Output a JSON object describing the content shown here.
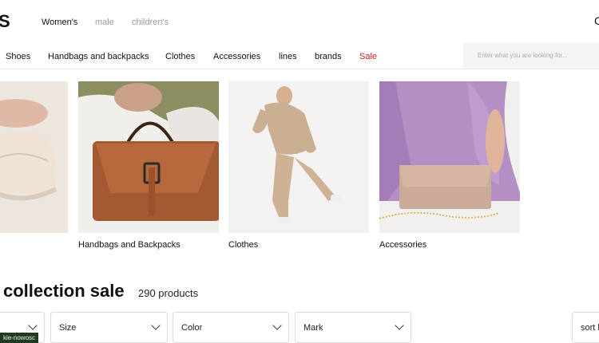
{
  "header": {
    "logo_fragment": "S",
    "genders": [
      "Women's",
      "male",
      "children's"
    ],
    "right_fragment": "C"
  },
  "nav": {
    "items": [
      "Shoes",
      "Handbags and backpacks",
      "Clothes",
      "Accessories",
      "lines",
      "brands",
      "Sale"
    ],
    "search_placeholder": "Enter what you are looking for..."
  },
  "categories": [
    {
      "label": ""
    },
    {
      "label": "Handbags and Backpacks"
    },
    {
      "label": "Clothes"
    },
    {
      "label": "Accessories"
    }
  ],
  "listing": {
    "title": "collection sale",
    "count": "290 products"
  },
  "filters": [
    "",
    "Size",
    "Color",
    "Mark"
  ],
  "sort_label": "sort b",
  "status_tag": "kie-nowosc",
  "colors": {
    "sale": "#c21f2f",
    "tag_bg": "#1f3b1f"
  }
}
